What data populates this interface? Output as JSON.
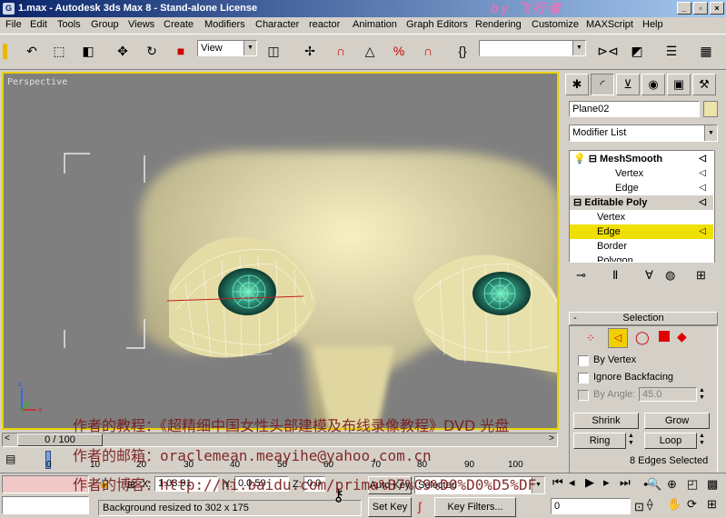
{
  "window": {
    "title": "1.max - Autodesk 3ds Max 8 - Stand-alone License",
    "app_icon": "3ds-max-icon",
    "min_label": "_",
    "max_label": "▫",
    "close_label": "×"
  },
  "menu": [
    "File",
    "Edit",
    "Tools",
    "Group",
    "Views",
    "Create",
    "Modifiers",
    "Character",
    "reactor",
    "Animation",
    "Graph Editors",
    "Rendering",
    "Customize",
    "MAXScript",
    "Help"
  ],
  "toolbar": {
    "ref_coord": "View",
    "selection_sets": ""
  },
  "viewport": {
    "label": "Perspective"
  },
  "command_panel": {
    "object_name": "Plane02",
    "object_color": "#ece4a8",
    "modifier_list": "Modifier List",
    "stack": [
      {
        "label": "MeshSmooth",
        "bold": true
      },
      {
        "label": "Vertex",
        "bold": false
      },
      {
        "label": "Edge",
        "bold": false
      },
      {
        "label": "Editable Poly",
        "bold": true
      },
      {
        "label": "Vertex",
        "bold": false
      },
      {
        "label": "Edge",
        "bold": false
      },
      {
        "label": "Border",
        "bold": false
      },
      {
        "label": "Polygon",
        "bold": false
      }
    ],
    "selection": {
      "title": "Selection",
      "by_vertex": "By Vertex",
      "ignore_backfacing": "Ignore Backfacing",
      "by_angle": "By Angle:",
      "by_angle_value": "45.0",
      "shrink": "Shrink",
      "grow": "Grow",
      "ring": "Ring",
      "loop": "Loop",
      "status": "8 Edges Selected"
    }
  },
  "timeline": {
    "frame_display": "0 / 100",
    "ticks": [
      "0",
      "10",
      "20",
      "30",
      "40",
      "50",
      "60",
      "70",
      "80",
      "90",
      "100"
    ]
  },
  "status": {
    "prompt": "Background resized to 302 x 175",
    "x_label": "X:",
    "x_value": "1.03.91",
    "y_label": "Y:",
    "y_value": "0.0.59",
    "z_label": "Z:",
    "z_value": "0.0",
    "auto_key": "Auto Key",
    "set_key": "Set Key",
    "selected": "Selected",
    "key_filters": "Key Filters...",
    "frame": "0"
  },
  "watermark": {
    "line1": "作者的教程：《超精细中国女性头部建模及布线录像教程》DVD 光盘",
    "line2": "作者的邮箱：oraclemean.meayihe@yahoo.com.cn",
    "line3": "作者的博客：http://hi.baidu.com/prima%B7%C9%D0%D0%D5%DF"
  }
}
